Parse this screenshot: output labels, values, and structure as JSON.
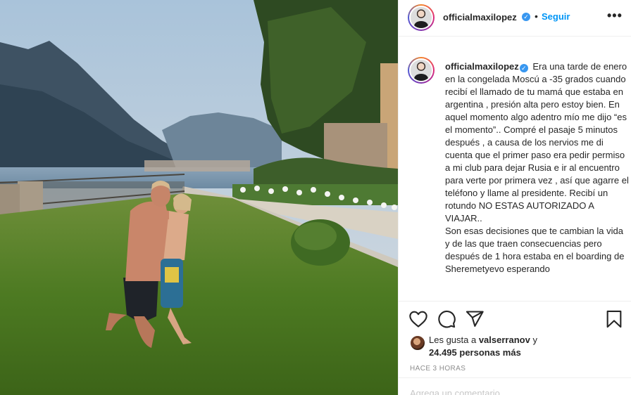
{
  "post": {
    "username": "officialmaxilopez",
    "verified_mark": "✓",
    "separator": "•",
    "follow_label": "Seguir",
    "more_label": "•••",
    "caption": "Era una tarde de enero en la congelada Moscú a -35 grados cuando recibí el llamado de tu mamá que estaba en argentina , presión alta pero estoy bien. En aquel momento algo adentro mío me dijo “es el momento”.. Compré el pasaje 5 minutos después , a causa de los nervios me di cuenta que el primer paso era pedir permiso a mi club para dejar Rusia e ir al encuentro para verte por primera vez , así que agarre el teléfono y llame al presidente. Recibí un rotundo NO ESTAS AUTORIZADO A VIAJAR..\nSon esas decisiones que te cambian la vida y de las que traen consecuencias pero después de 1 hora estaba en el boarding de Sheremetyevo esperando"
  },
  "actions": {
    "like_icon": "heart-icon",
    "comment_icon": "comment-icon",
    "share_icon": "send-icon",
    "save_icon": "bookmark-icon"
  },
  "likes": {
    "prefix": "Les gusta a ",
    "user": "valserranov",
    "connector": " y",
    "count": "24.495 personas más"
  },
  "timestamp": "HACE 3 HORAS",
  "comment_placeholder": "Agrega un comentario..."
}
